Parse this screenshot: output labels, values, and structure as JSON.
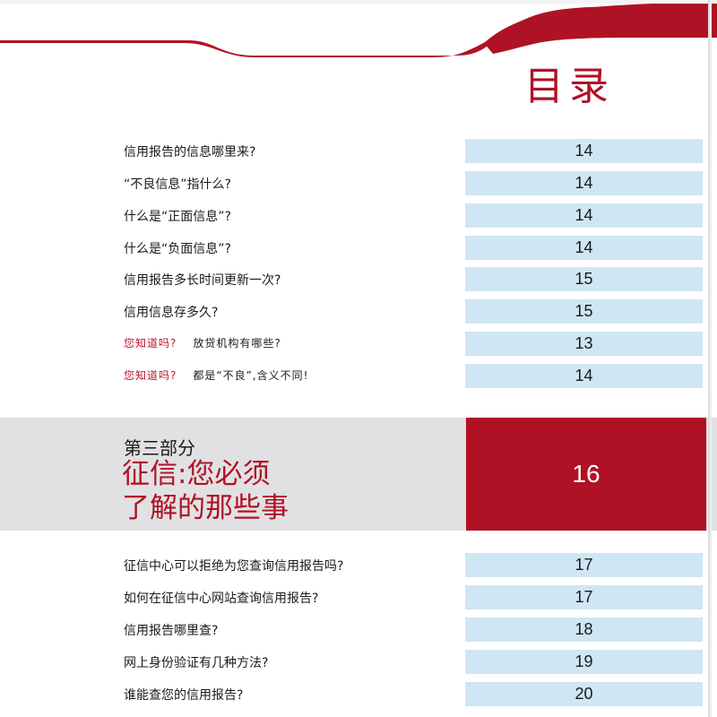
{
  "page": {
    "title": "目录"
  },
  "colors": {
    "brand_red": "#b01225",
    "number_bg": "#cfe6f5",
    "band_bg": "#e1e1e3"
  },
  "entries_a": [
    {
      "label": "信用报告的信息哪里来?",
      "page": "14"
    },
    {
      "label": "“不良信息”指什么?",
      "page": "14"
    },
    {
      "label": "什么是“正面信息”?",
      "page": "14"
    },
    {
      "label": "什么是“负面信息”?",
      "page": "14"
    },
    {
      "label": "信用报告多长时间更新一次?",
      "page": "15"
    },
    {
      "label": "信用信息存多久?",
      "page": "15"
    }
  ],
  "tips": [
    {
      "tag": "您知道吗?",
      "text": "放贷机构有哪些?",
      "page": "13"
    },
    {
      "tag": "您知道吗?",
      "text": "都是“不良”,含义不同!",
      "page": "14"
    }
  ],
  "section": {
    "kicker": "第三部分",
    "title_line1": "征信:您必须",
    "title_line2": "了解的那些事",
    "page": "16"
  },
  "entries_b": [
    {
      "label": "征信中心可以拒绝为您查询信用报告吗?",
      "page": "17"
    },
    {
      "label": "如何在征信中心网站查询信用报告?",
      "page": "17"
    },
    {
      "label": "信用报告哪里查?",
      "page": "18"
    },
    {
      "label": "网上身份验证有几种方法?",
      "page": "19"
    },
    {
      "label": "谁能查您的信用报告?",
      "page": "20"
    }
  ]
}
